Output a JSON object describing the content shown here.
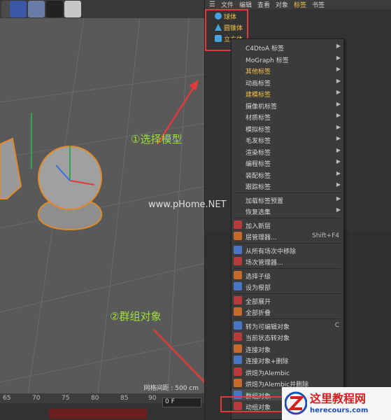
{
  "menubar": {
    "items": [
      "文件",
      "编辑",
      "查看",
      "对象",
      "标签",
      "书签"
    ],
    "active_index": 4
  },
  "objects": [
    {
      "label": "球体",
      "icon": "sphere-icon"
    },
    {
      "label": "圆锥体",
      "icon": "cone-icon"
    },
    {
      "label": "立方体",
      "icon": "cube-icon"
    }
  ],
  "context_menu": {
    "items": [
      {
        "label": "C4DtoA 标签",
        "submenu": true
      },
      {
        "label": "MoGraph 标签",
        "submenu": true
      },
      {
        "label": "其他标签",
        "submenu": true,
        "yellow": true
      },
      {
        "label": "动画标签",
        "submenu": true
      },
      {
        "label": "建模标签",
        "submenu": true,
        "yellow": true
      },
      {
        "label": "摄像机标签",
        "submenu": true
      },
      {
        "label": "材质标签",
        "submenu": true
      },
      {
        "label": "模拟标签",
        "submenu": true
      },
      {
        "label": "毛发标签",
        "submenu": true
      },
      {
        "label": "渲染标签",
        "submenu": true
      },
      {
        "label": "编程标签",
        "submenu": true
      },
      {
        "label": "装配标签",
        "submenu": true
      },
      {
        "label": "跟踪标签",
        "submenu": true
      },
      {
        "label": "加载标签预置",
        "submenu": true
      },
      {
        "label": "恢复选集",
        "submenu": true
      },
      {
        "label": "加入新层",
        "icon": true
      },
      {
        "label": "层管理器...",
        "shortcut": "Shift+F4",
        "icon": true
      },
      {
        "label": "从所有场次中移除",
        "icon": true
      },
      {
        "label": "场次管理器...",
        "icon": true
      },
      {
        "label": "选择子级",
        "icon": true
      },
      {
        "label": "设为根部",
        "icon": true
      },
      {
        "label": "全部展开",
        "icon": true
      },
      {
        "label": "全部折叠",
        "icon": true
      },
      {
        "label": "转为可编辑对象",
        "shortcut": "C",
        "icon": true
      },
      {
        "label": "当前状态转对象",
        "icon": true
      },
      {
        "label": "连接对象",
        "icon": true
      },
      {
        "label": "连接对象+删除",
        "icon": true
      },
      {
        "label": "烘焙为Alembic",
        "icon": true
      },
      {
        "label": "烘焙为Alembic并删除",
        "icon": true
      },
      {
        "label": "群组对象",
        "icon": true
      },
      {
        "label": "动组对象",
        "icon": true
      }
    ]
  },
  "annotations": {
    "step1": "①选择模型",
    "step2": "②群组对象",
    "watermark": "www.pHome.NET"
  },
  "viewport": {
    "grid_info": "网格间距 : 500 cm"
  },
  "timeline": {
    "frame_value": "0 F",
    "ruler_labels": [
      "65",
      "70",
      "75",
      "80",
      "85",
      "90"
    ]
  },
  "logo": {
    "title": "这里教程网",
    "url": "herecours.com"
  },
  "colors": {
    "highlight": "#e23a3a",
    "annotation": "#9ee03a",
    "active_menu": "#f0c24a"
  }
}
